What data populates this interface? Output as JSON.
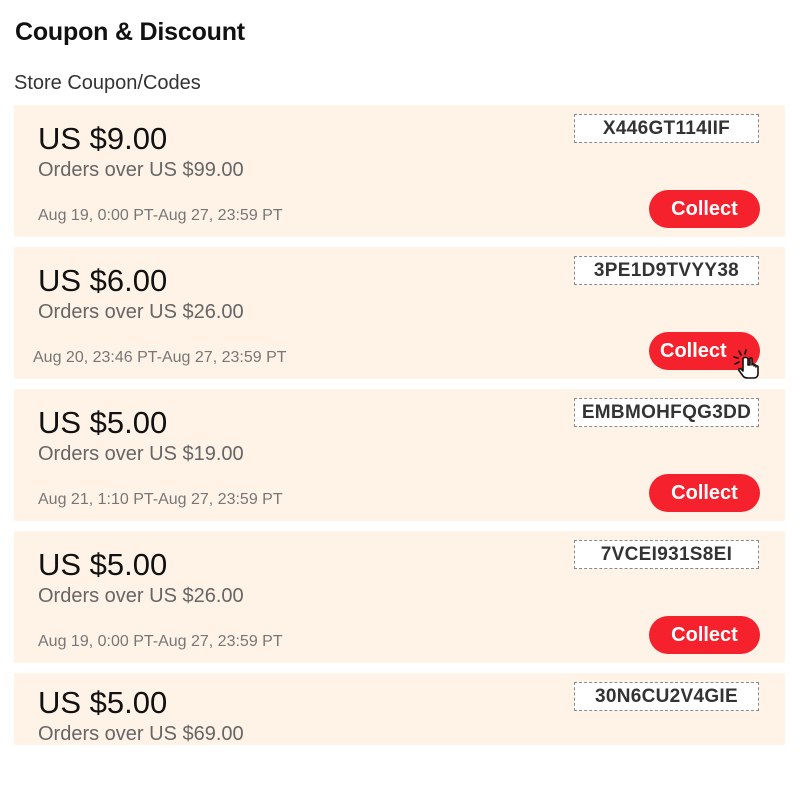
{
  "header": {
    "title": "Coupon & Discount"
  },
  "section": {
    "label": "Store Coupon/Codes"
  },
  "coupons": [
    {
      "amount": "US $9.00",
      "threshold": "Orders over US $99.00",
      "period": "Aug 19, 0:00 PT-Aug 27, 23:59 PT",
      "code": "X446GT114IIF",
      "button": "Collect"
    },
    {
      "amount": "US $6.00",
      "threshold": "Orders over US $26.00",
      "period": "Aug 20, 23:46 PT-Aug 27, 23:59 PT",
      "code": "3PE1D9TVYY38",
      "button": "Collect"
    },
    {
      "amount": "US $5.00",
      "threshold": "Orders over US $19.00",
      "period": "Aug 21, 1:10 PT-Aug 27, 23:59 PT",
      "code": "EMBMOHFQG3DD",
      "button": "Collect"
    },
    {
      "amount": "US $5.00",
      "threshold": "Orders over US $26.00",
      "period": "Aug 19, 0:00 PT-Aug 27, 23:59 PT",
      "code": "7VCEI931S8EI",
      "button": "Collect"
    },
    {
      "amount": "US $5.00",
      "threshold": "Orders over US $69.00",
      "code": "30N6CU2V4GIE"
    }
  ],
  "colors": {
    "card_bg": "#fff2e6",
    "accent": "#f5222d"
  },
  "icons": {
    "cursor": "hand-pointer-click-icon"
  }
}
